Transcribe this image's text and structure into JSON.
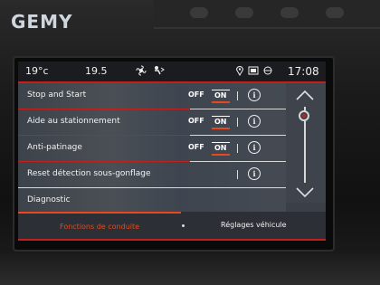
{
  "watermark": {
    "logo": "GEMY"
  },
  "status_bar": {
    "temp_left": "19°c",
    "temp_right": "19.5",
    "time": "17:08",
    "icons": [
      "fan-icon",
      "airflow-icon",
      "location-icon",
      "phone-icon",
      "connection-icon"
    ]
  },
  "settings": [
    {
      "label": "Stop and Start",
      "toggle": {
        "off": "OFF",
        "on": "ON"
      },
      "state": "on"
    },
    {
      "label": "Aide au stationnement",
      "toggle": {
        "off": "OFF",
        "on": "ON"
      },
      "state": "on"
    },
    {
      "label": "Anti-patinage",
      "toggle": {
        "off": "OFF",
        "on": "ON"
      },
      "state": "on"
    },
    {
      "label": "Reset détection sous-gonflage"
    },
    {
      "label": "Diagnostic"
    }
  ],
  "info_glyph": "i",
  "tabs": [
    {
      "label": "Fonctions de conduite",
      "active": true
    },
    {
      "label": "Réglages véhicule",
      "active": false
    }
  ],
  "colors": {
    "accent": "#e8481c",
    "separator": "#c4201b",
    "background": "#3b3f47"
  }
}
